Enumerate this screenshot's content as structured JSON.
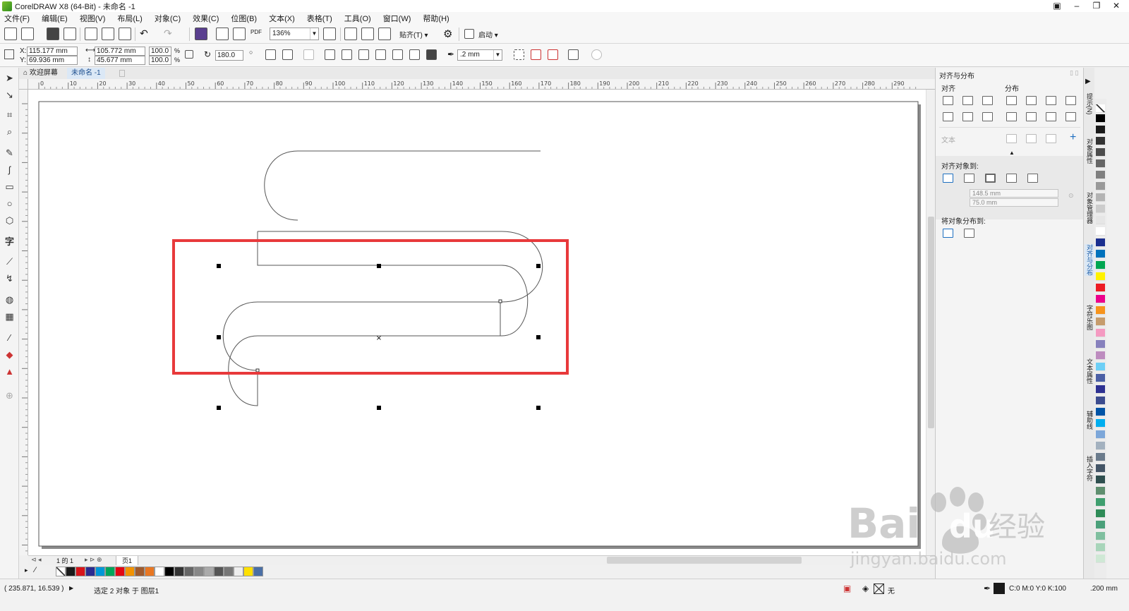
{
  "window": {
    "title": "CorelDRAW X8 (64-Bit) - 未命名 -1"
  },
  "menu": [
    "文件(F)",
    "编辑(E)",
    "视图(V)",
    "布局(L)",
    "对象(C)",
    "效果(C)",
    "位图(B)",
    "文本(X)",
    "表格(T)",
    "工具(O)",
    "窗口(W)",
    "帮助(H)"
  ],
  "toolbar": {
    "zoom": "136%",
    "snap_label": "贴齐(T)",
    "launch_label": "启动",
    "pdf_label": "PDF"
  },
  "properties": {
    "x": "115.177 mm",
    "y": "69.936 mm",
    "width": "105.772 mm",
    "height": "45.677 mm",
    "scale_x": "100.0",
    "scale_y": "100.0",
    "percent": "%",
    "rotation": "180.0",
    "outline_width": ".2 mm",
    "x_label": "X:",
    "y_label": "Y:"
  },
  "tabs": {
    "welcome": "欢迎屏幕",
    "document": "未命名 -1"
  },
  "ruler": {
    "h_ticks": [
      "0",
      "10",
      "20",
      "30",
      "40",
      "50",
      "60",
      "70",
      "80",
      "90",
      "100",
      "110",
      "120",
      "130",
      "140",
      "150",
      "160",
      "170",
      "180",
      "190",
      "200",
      "210",
      "220",
      "230",
      "240",
      "250",
      "260",
      "270",
      "280",
      "290"
    ],
    "unit": "毫米"
  },
  "pagenav": {
    "count": "1 的 1",
    "page": "页1"
  },
  "docker": {
    "title": "对齐与分布",
    "align_label": "对齐",
    "distribute_label": "分布",
    "text_label": "文本",
    "align_to_label": "对齐对象到:",
    "x_value": "148.5 mm",
    "y_value": "75.0 mm",
    "distribute_to_label": "将对象分布到:"
  },
  "vtabs": [
    "提示(N)",
    "对象属性",
    "对象管理器",
    "对齐与分布",
    "字符乐图",
    "文本属性",
    "辅助线",
    "插入字符"
  ],
  "status": {
    "cursor": "( 235.871, 16.539 )",
    "selection": "选定 2 对象 于 图层1",
    "fill_none": "无",
    "outline_color": "C:0 M:0 Y:0 K:100",
    "outline_width": ".200 mm"
  },
  "watermark": {
    "brand": "Bai",
    "brand2": "du",
    "cn": "经验",
    "url": "jingyan.baidu.com"
  },
  "colors": {
    "highlight_red": "#e8393b",
    "accent_blue": "#1e6fc0"
  }
}
